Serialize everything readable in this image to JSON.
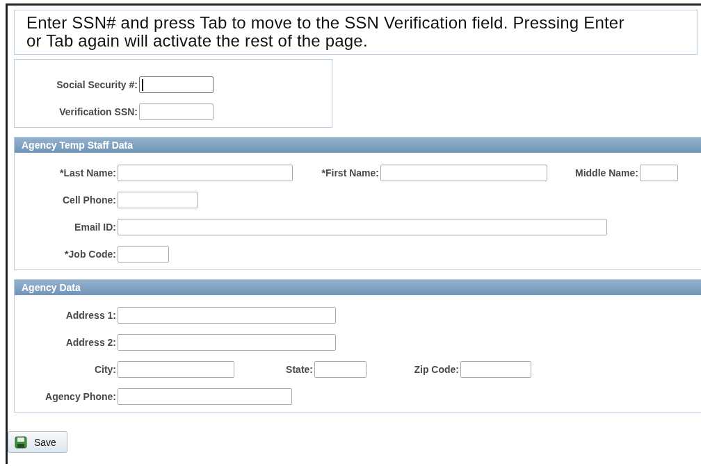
{
  "instructions": "Enter SSN# and press Tab to move to the SSN Verification field. Pressing Enter or Tab again will activate the rest of the page.",
  "ssn_panel": {
    "fields": [
      {
        "label": "Social Security #:",
        "focused": true
      },
      {
        "label": "Verification SSN:",
        "focused": false
      }
    ]
  },
  "sections": [
    {
      "title": "Agency Temp Staff Data",
      "rows": [
        [
          {
            "label": "*Last Name:"
          },
          {
            "label": "*First Name:"
          },
          {
            "label": "Middle Name:"
          }
        ],
        [
          {
            "label": "Cell Phone:"
          }
        ],
        [
          {
            "label": "Email ID:"
          }
        ],
        [
          {
            "label": "*Job Code:"
          }
        ]
      ]
    },
    {
      "title": "Agency Data",
      "rows": [
        [
          {
            "label": "Address 1:"
          }
        ],
        [
          {
            "label": "Address 2:"
          }
        ],
        [
          {
            "label": "City:"
          },
          {
            "label": "State:"
          },
          {
            "label": "Zip Code:"
          }
        ],
        [
          {
            "label": "Agency Phone:"
          }
        ]
      ]
    }
  ],
  "save_button": "Save"
}
